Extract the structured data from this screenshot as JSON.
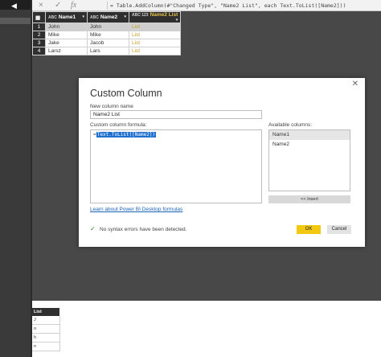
{
  "formula_bar": {
    "cancel_icon": "×",
    "confirm_icon": "✓",
    "fx_label": "fx",
    "formula": "= Table.AddColumn(#\"Changed Type\", \"Name2 List\", each Text.ToList([Name2]))"
  },
  "table": {
    "headers": [
      {
        "type": "ABC",
        "label": "Name1"
      },
      {
        "type": "ABC",
        "label": "Name2"
      },
      {
        "type": "ABC 123",
        "label": "Name2 List"
      }
    ],
    "rows": [
      {
        "num": "1",
        "name1": "John",
        "name2": "John",
        "list": "List"
      },
      {
        "num": "2",
        "name1": "Mike",
        "name2": "Mike",
        "list": "List"
      },
      {
        "num": "3",
        "name1": "Jake",
        "name2": "Jacob",
        "list": "List"
      },
      {
        "num": "4",
        "name1": "Larsz",
        "name2": "Lars",
        "list": "List"
      }
    ]
  },
  "dialog": {
    "title": "Custom Column",
    "close_icon": "✕",
    "new_column_label": "New column name",
    "new_column_value": "Name2 List",
    "formula_label": "Custom column formula:",
    "formula_prefix": "=",
    "formula_value": "Text.ToList([Name2])",
    "available_label": "Available columns:",
    "available_columns": [
      "Name1",
      "Name2"
    ],
    "insert_label": "<< Insert",
    "learn_link": "Learn about Power BI Desktop formulas",
    "status_text": "No syntax errors have been detected.",
    "ok_label": "OK",
    "cancel_label": "Cancel"
  },
  "list_preview": {
    "header": "List",
    "items": [
      "J",
      "o",
      "h",
      "n"
    ]
  }
}
